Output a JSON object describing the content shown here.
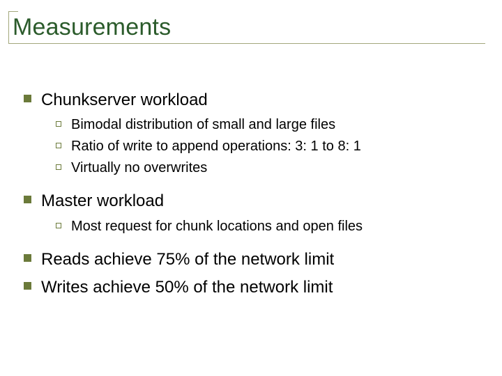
{
  "title": "Measurements",
  "items": [
    {
      "label": "Chunkserver workload",
      "children": [
        "Bimodal distribution of small and large files",
        "Ratio of write to append operations:  3: 1 to 8: 1",
        "Virtually no overwrites"
      ]
    },
    {
      "label": "Master workload",
      "children": [
        "Most request for chunk locations and open files"
      ]
    },
    {
      "label": "Reads achieve 75% of the network limit",
      "children": []
    },
    {
      "label": "Writes achieve 50% of the network limit",
      "children": []
    }
  ]
}
